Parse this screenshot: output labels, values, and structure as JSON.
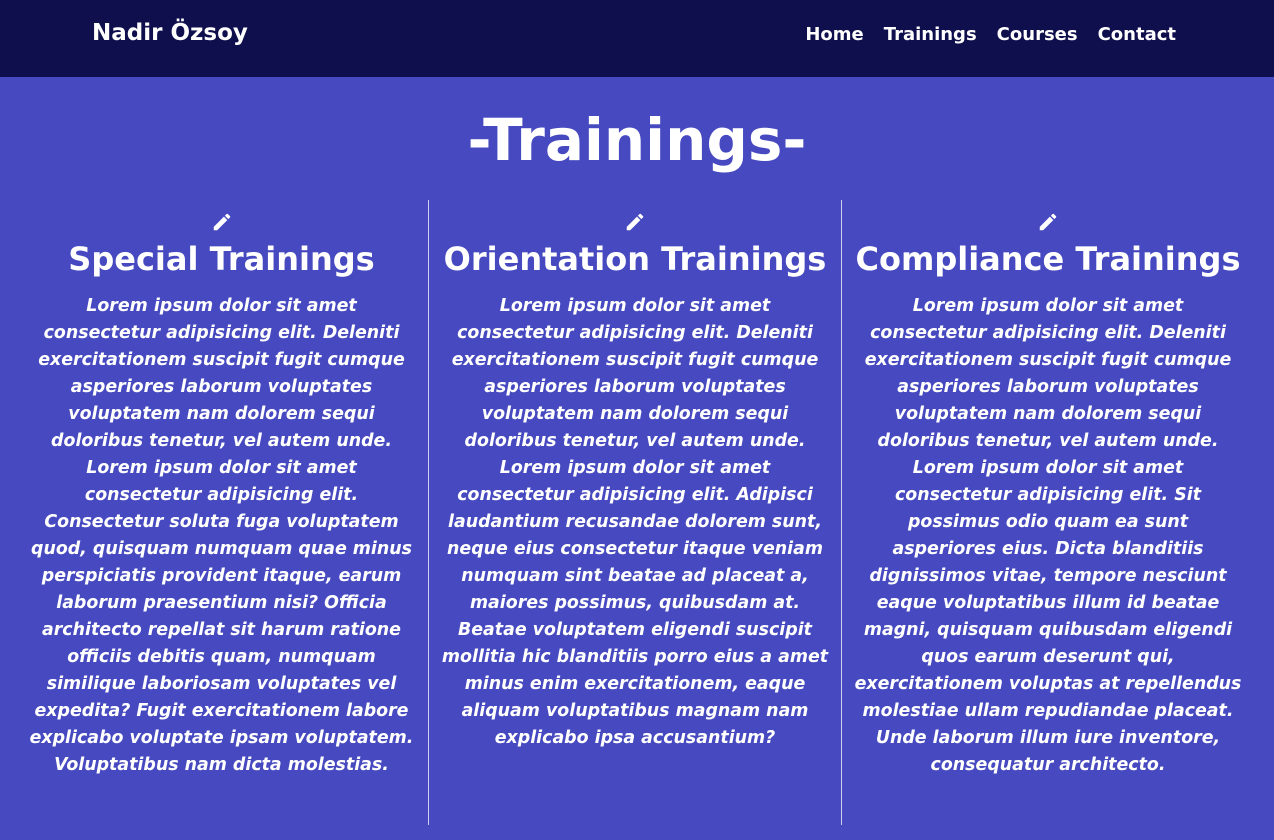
{
  "navbar": {
    "brand": "Nadir Özsoy",
    "links": [
      "Home",
      "Trainings",
      "Courses",
      "Contact"
    ]
  },
  "page": {
    "title": "-Trainings-"
  },
  "icons": {
    "column_icon": "pencil-icon"
  },
  "colors": {
    "background": "#4649bf",
    "navbar": "#0f0f4d",
    "text": "#ffffff"
  },
  "columns": [
    {
      "title": "Special Trainings",
      "text": "Lorem ipsum dolor sit amet consectetur adipisicing elit. Deleniti exercitationem suscipit fugit cumque asperiores laborum voluptates voluptatem nam dolorem sequi doloribus tenetur, vel autem unde. Lorem ipsum dolor sit amet consectetur adipisicing elit. Consectetur soluta fuga voluptatem quod, quisquam numquam quae minus perspiciatis provident itaque, earum laborum praesentium nisi? Officia architecto repellat sit harum ratione officiis debitis quam, numquam similique laboriosam voluptates vel expedita? Fugit exercitationem labore explicabo voluptate ipsam voluptatem. Voluptatibus nam dicta molestias."
    },
    {
      "title": "Orientation Trainings",
      "text": "Lorem ipsum dolor sit amet consectetur adipisicing elit. Deleniti exercitationem suscipit fugit cumque asperiores laborum voluptates voluptatem nam dolorem sequi doloribus tenetur, vel autem unde. Lorem ipsum dolor sit amet consectetur adipisicing elit. Adipisci laudantium recusandae dolorem sunt, neque eius consectetur itaque veniam numquam sint beatae ad placeat a, maiores possimus, quibusdam at. Beatae voluptatem eligendi suscipit mollitia hic blanditiis porro eius a amet minus enim exercitationem, eaque aliquam voluptatibus magnam nam explicabo ipsa accusantium?"
    },
    {
      "title": "Compliance Trainings",
      "text": "Lorem ipsum dolor sit amet consectetur adipisicing elit. Deleniti exercitationem suscipit fugit cumque asperiores laborum voluptates voluptatem nam dolorem sequi doloribus tenetur, vel autem unde. Lorem ipsum dolor sit amet consectetur adipisicing elit. Sit possimus odio quam ea sunt asperiores eius. Dicta blanditiis dignissimos vitae, tempore nesciunt eaque voluptatibus illum id beatae magni, quisquam quibusdam eligendi quos earum deserunt qui, exercitationem voluptas at repellendus molestiae ullam repudiandae placeat. Unde laborum illum iure inventore, consequatur architecto."
    }
  ]
}
